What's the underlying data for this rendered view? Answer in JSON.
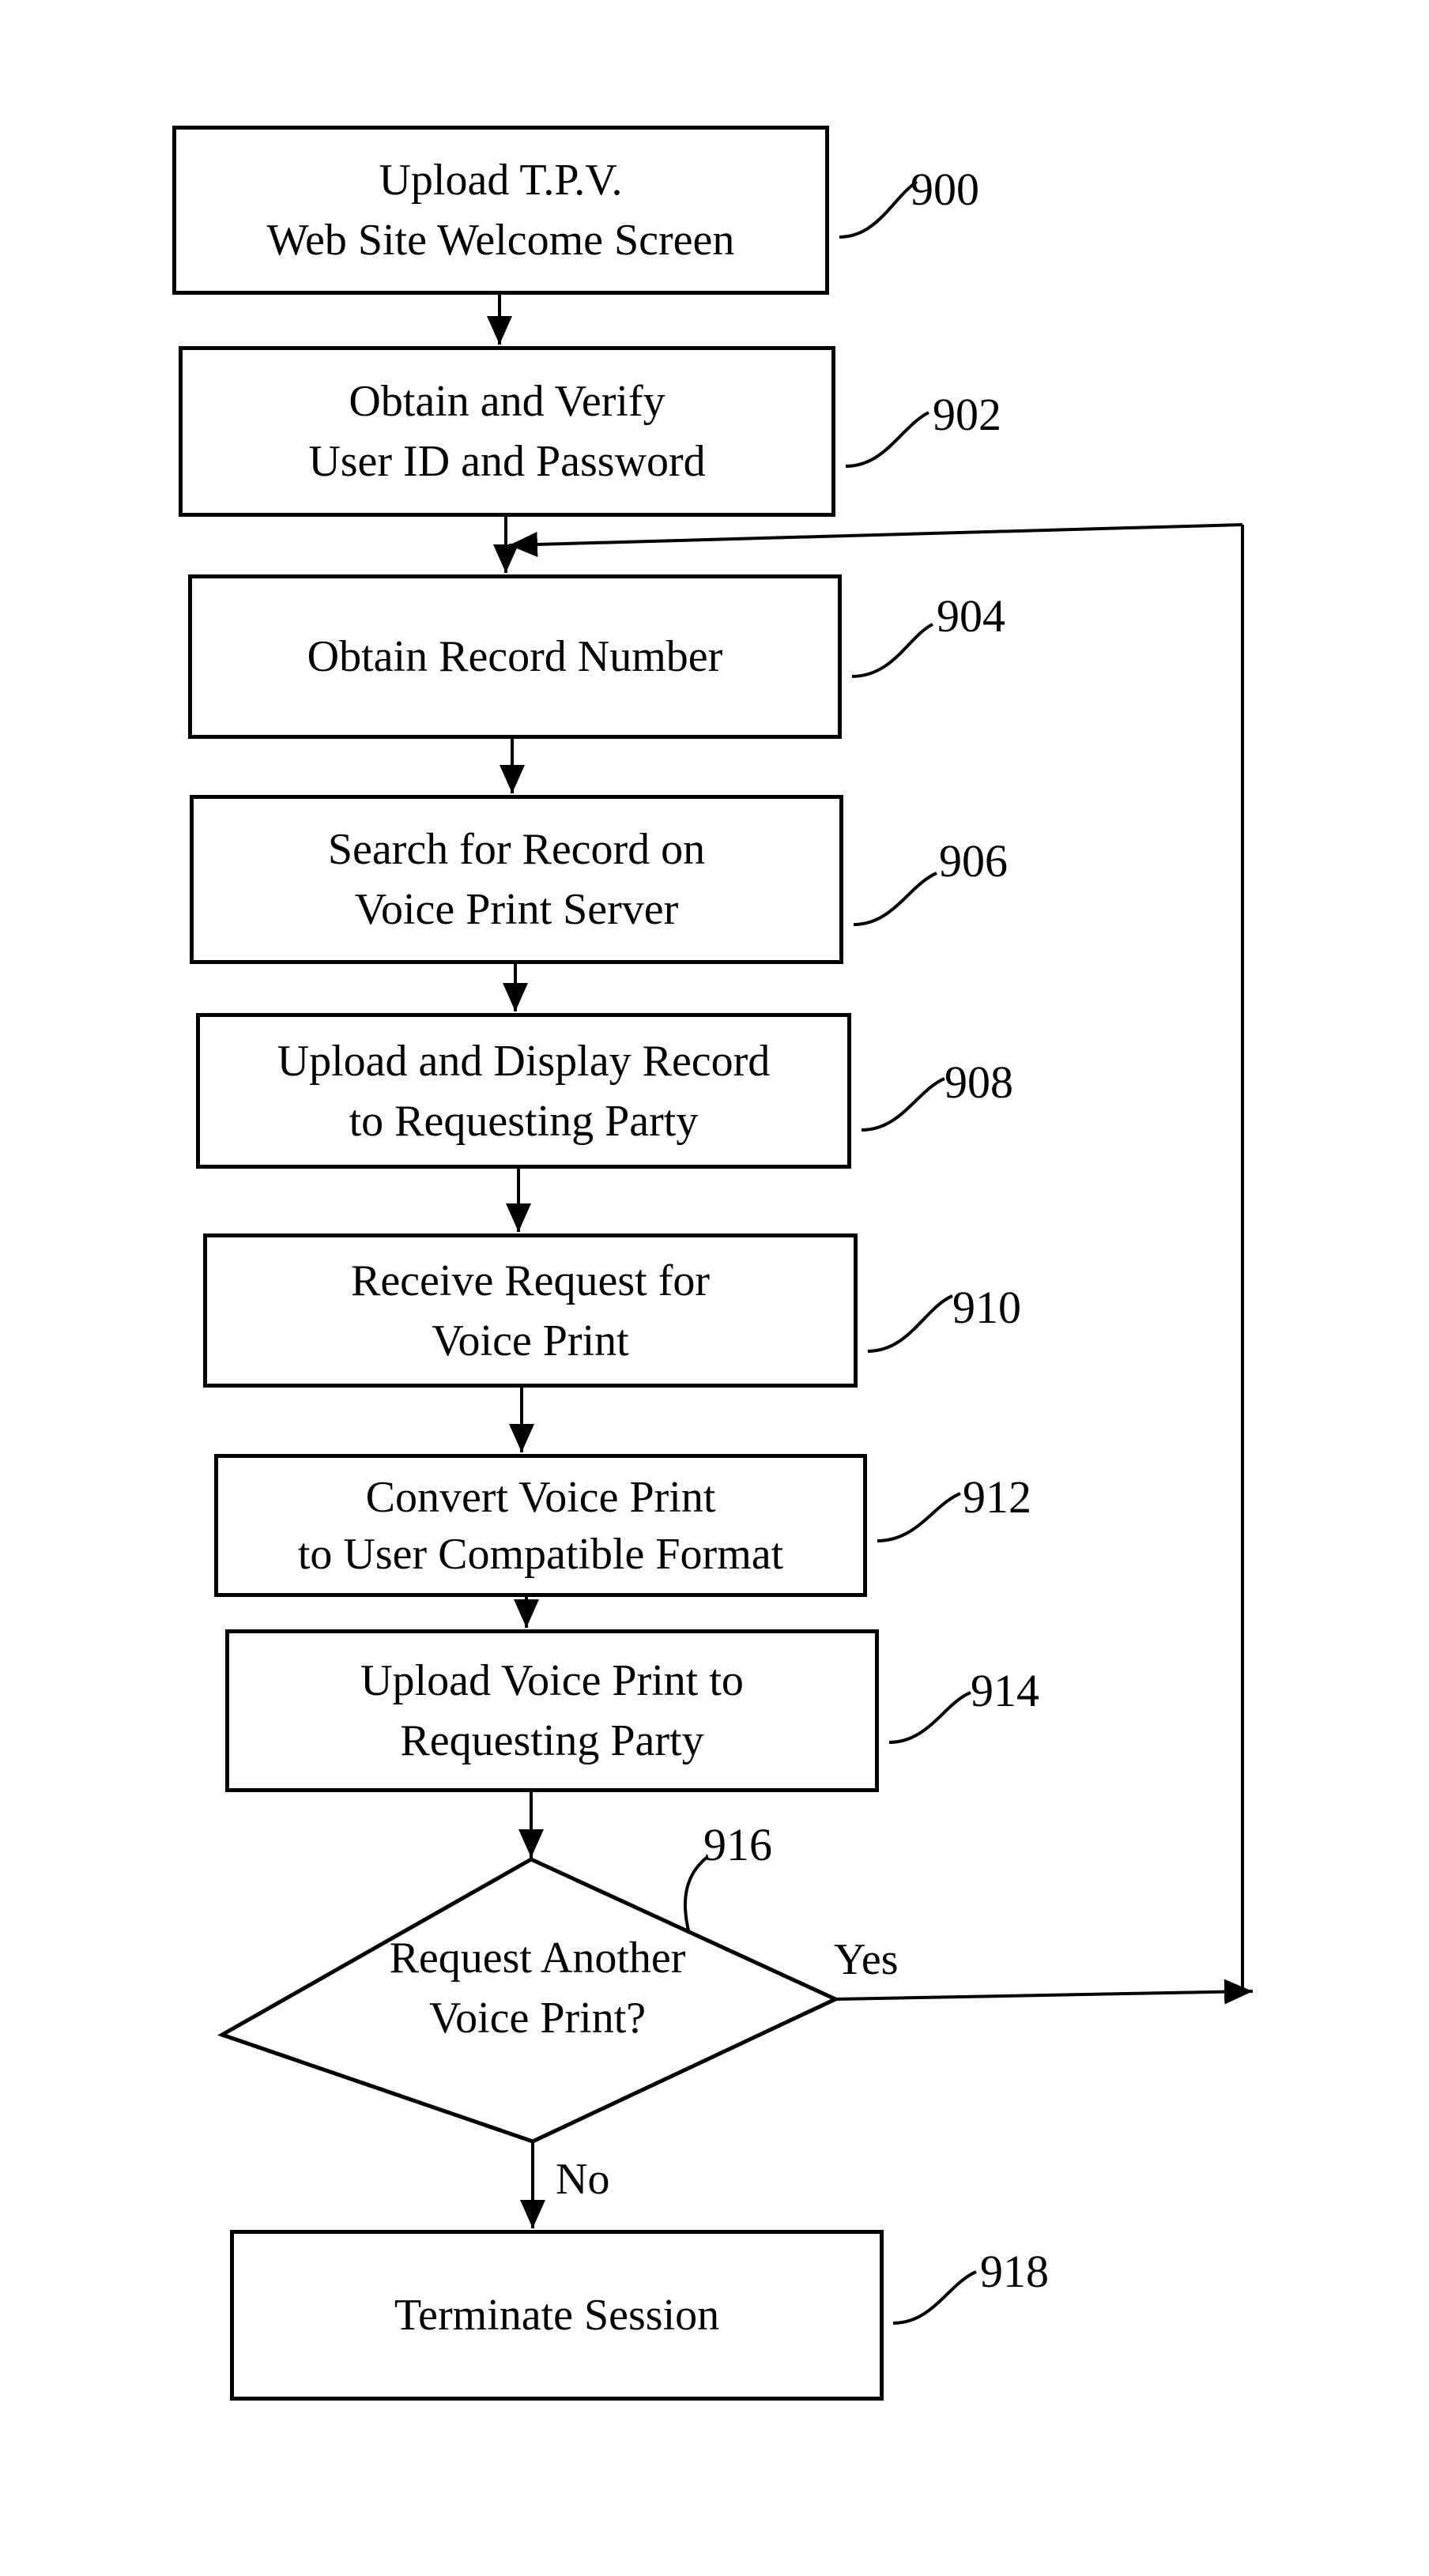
{
  "steps": [
    {
      "id": "900",
      "lines": [
        "Upload T.P.V.",
        "Web Site Welcome Screen"
      ]
    },
    {
      "id": "902",
      "lines": [
        "Obtain and Verify",
        "User ID and Password"
      ]
    },
    {
      "id": "904",
      "lines": [
        "Obtain Record Number"
      ]
    },
    {
      "id": "906",
      "lines": [
        "Search for Record on",
        "Voice Print Server"
      ]
    },
    {
      "id": "908",
      "lines": [
        "Upload and Display Record",
        "to Requesting Party"
      ]
    },
    {
      "id": "910",
      "lines": [
        "Receive Request for",
        "Voice Print"
      ]
    },
    {
      "id": "912",
      "lines": [
        "Convert Voice Print",
        "to User Compatible Format"
      ]
    },
    {
      "id": "914",
      "lines": [
        "Upload Voice Print to",
        "Requesting Party"
      ]
    },
    {
      "id": "918",
      "lines": [
        "Terminate Session"
      ]
    }
  ],
  "decision": {
    "id": "916",
    "lines": [
      "Request Another",
      "Voice Print?"
    ],
    "yes_label": "Yes",
    "no_label": "No"
  },
  "colors": {
    "stroke": "#000000",
    "background": "#ffffff"
  }
}
